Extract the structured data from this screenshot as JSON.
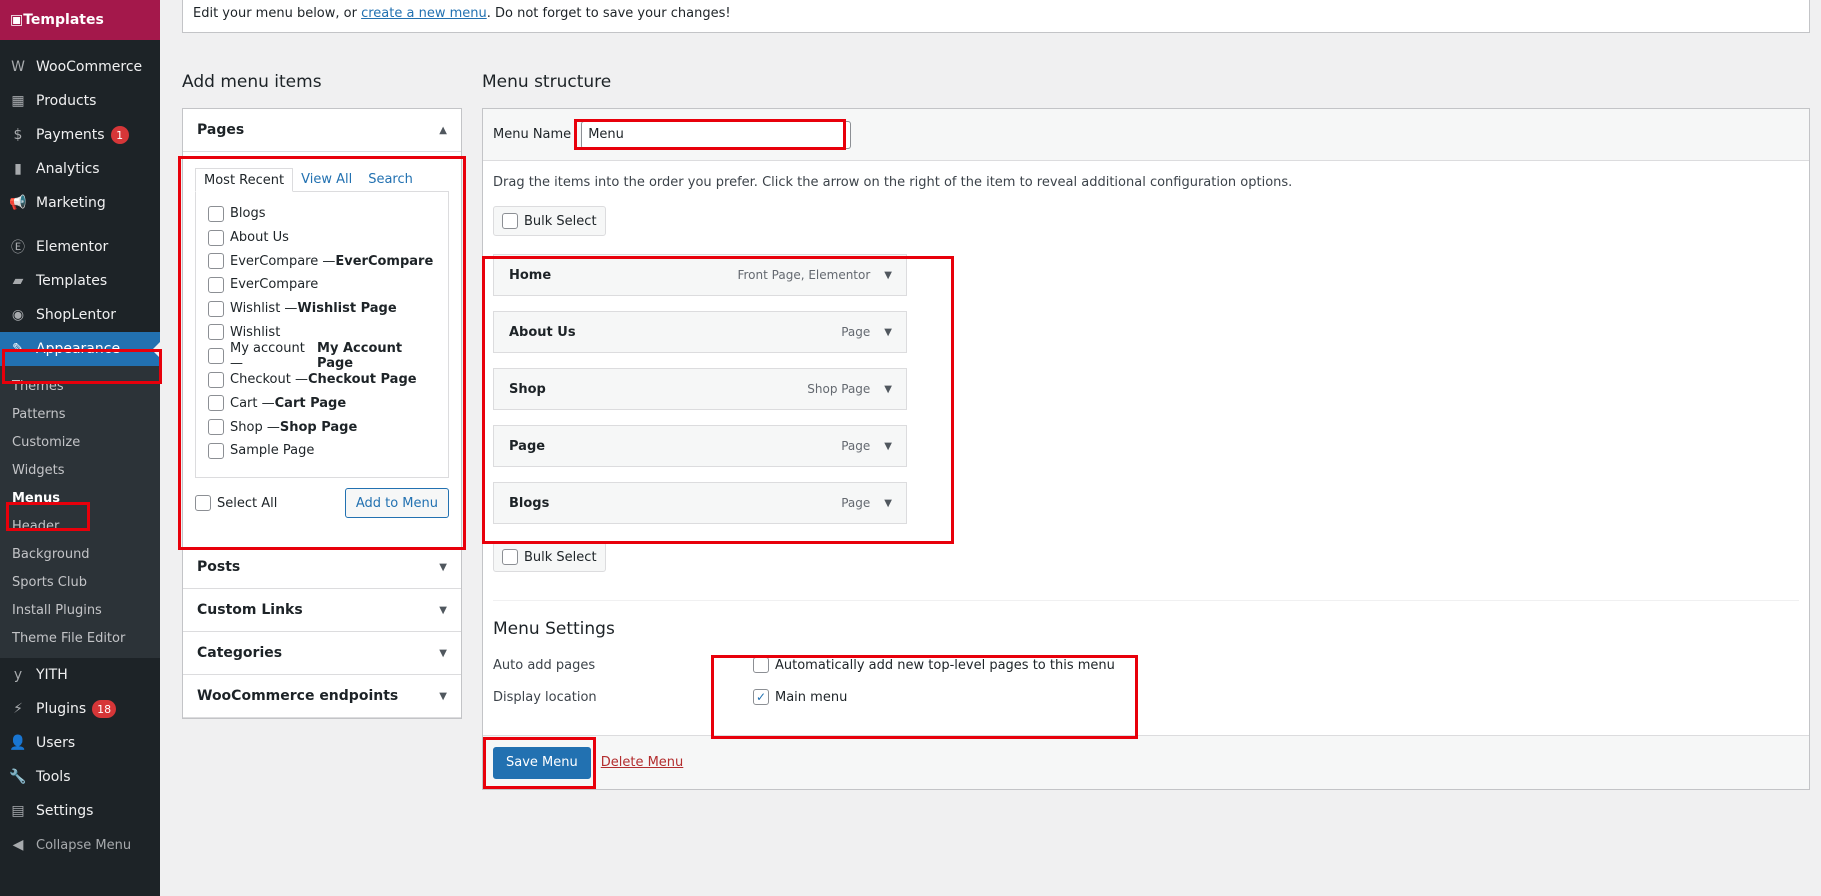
{
  "sidebar": {
    "top": "Templates",
    "items": [
      {
        "label": "WooCommerce",
        "icon": "woo-icon",
        "glyph": "W"
      },
      {
        "label": "Products",
        "icon": "archive-icon",
        "glyph": "▦"
      },
      {
        "label": "Payments",
        "icon": "dollar-icon",
        "glyph": "$",
        "badge": "1"
      },
      {
        "label": "Analytics",
        "icon": "bar-chart-icon",
        "glyph": "▮"
      },
      {
        "label": "Marketing",
        "icon": "megaphone-icon",
        "glyph": "📢"
      },
      {
        "label": "Elementor",
        "icon": "elementor-icon",
        "glyph": "Ⓔ"
      },
      {
        "label": "Templates",
        "icon": "folder-icon",
        "glyph": "▰"
      },
      {
        "label": "ShopLentor",
        "icon": "shoplentor-icon",
        "glyph": "◉"
      },
      {
        "label": "Appearance",
        "icon": "brush-icon",
        "glyph": "✎"
      }
    ],
    "submenu": [
      "Themes",
      "Patterns",
      "Customize",
      "Widgets",
      "Menus",
      "Header",
      "Background",
      "Sports Club",
      "Install Plugins",
      "Theme File Editor"
    ],
    "items_after": [
      {
        "label": "YITH",
        "icon": "yith-icon",
        "glyph": "y"
      },
      {
        "label": "Plugins",
        "icon": "plug-icon",
        "glyph": "⚡",
        "badge": "18"
      },
      {
        "label": "Users",
        "icon": "user-icon",
        "glyph": "👤"
      },
      {
        "label": "Tools",
        "icon": "wrench-icon",
        "glyph": "🔧"
      },
      {
        "label": "Settings",
        "icon": "settings-icon",
        "glyph": "▤"
      }
    ],
    "collapse": "Collapse Menu"
  },
  "notice": {
    "before": "Edit your menu below, or ",
    "link": "create a new menu",
    "after": ". Do not forget to save your changes!"
  },
  "add_items": {
    "title": "Add menu items",
    "pages_title": "Pages",
    "tabs": [
      "Most Recent",
      "View All",
      "Search"
    ],
    "pages": [
      {
        "label": "Blogs",
        "suffix": ""
      },
      {
        "label": "About Us",
        "suffix": ""
      },
      {
        "label": "EverCompare — ",
        "suffix": "EverCompare"
      },
      {
        "label": "EverCompare",
        "suffix": ""
      },
      {
        "label": "Wishlist — ",
        "suffix": "Wishlist Page"
      },
      {
        "label": "Wishlist",
        "suffix": ""
      },
      {
        "label": "My account — ",
        "suffix": "My Account Page"
      },
      {
        "label": "Checkout — ",
        "suffix": "Checkout Page"
      },
      {
        "label": "Cart — ",
        "suffix": "Cart Page"
      },
      {
        "label": "Shop — ",
        "suffix": "Shop Page"
      },
      {
        "label": "Sample Page",
        "suffix": ""
      }
    ],
    "select_all": "Select All",
    "add_button": "Add to Menu",
    "other_sections": [
      "Posts",
      "Custom Links",
      "Categories",
      "WooCommerce endpoints"
    ]
  },
  "structure": {
    "title": "Menu structure",
    "name_label": "Menu Name",
    "name_value": "Menu",
    "instructions": "Drag the items into the order you prefer. Click the arrow on the right of the item to reveal additional configuration options.",
    "bulk_select": "Bulk Select",
    "items": [
      {
        "title": "Home",
        "type": "Front Page, Elementor"
      },
      {
        "title": "About Us",
        "type": "Page"
      },
      {
        "title": "Shop",
        "type": "Shop Page"
      },
      {
        "title": "Page",
        "type": "Page"
      },
      {
        "title": "Blogs",
        "type": "Page"
      }
    ],
    "settings_title": "Menu Settings",
    "auto_add_label": "Auto add pages",
    "auto_add_text": "Automatically add new top-level pages to this menu",
    "display_label": "Display location",
    "display_text": "Main menu",
    "save_button": "Save Menu",
    "delete_link": "Delete Menu"
  }
}
